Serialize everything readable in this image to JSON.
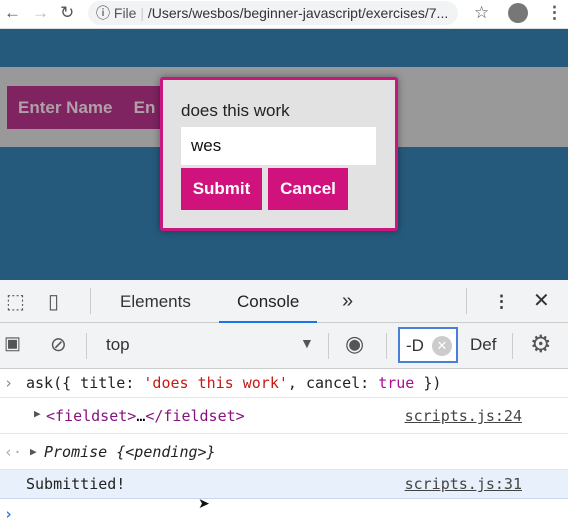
{
  "browser": {
    "file_label": "File",
    "url": "/Users/wesbos/beginner-javascript/exercises/7..."
  },
  "page": {
    "buttons": [
      "Enter Name",
      "En"
    ]
  },
  "modal": {
    "title": "does this work",
    "input_value": "wes",
    "submit": "Submit",
    "cancel": "Cancel"
  },
  "devtools": {
    "tabs": [
      "Elements",
      "Console"
    ],
    "more": "»",
    "context": "top",
    "filter": "-D",
    "levels": "Def",
    "console": [
      {
        "type": "input",
        "text_parts": [
          "ask({ title: ",
          "'does this work'",
          ", cancel: ",
          "true",
          " })"
        ]
      },
      {
        "type": "log",
        "text_parts": [
          "<fieldset>",
          "…",
          "</fieldset>"
        ],
        "source": "scripts.js:24"
      },
      {
        "type": "return",
        "text": "Promise {<pending>}"
      },
      {
        "type": "log",
        "text": "Submittied!",
        "source": "scripts.js:31"
      }
    ]
  },
  "colors": {
    "accent": "#cf127c",
    "page_bg": "#265a7c",
    "selected_row": "#e8f0fb"
  }
}
